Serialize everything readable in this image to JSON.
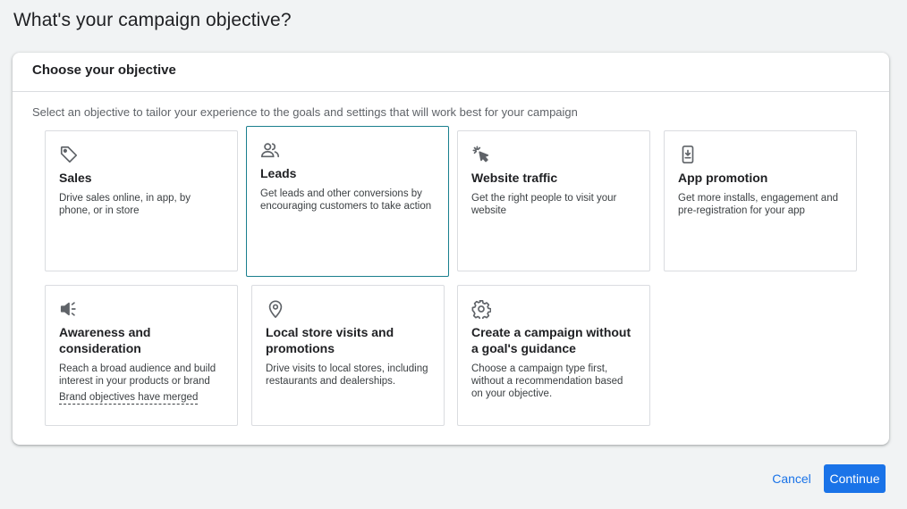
{
  "page": {
    "title": "What's your campaign objective?"
  },
  "panel": {
    "header": "Choose your objective",
    "description": "Select an objective to tailor your experience to the goals and settings that will work best for your campaign"
  },
  "objectives": [
    {
      "id": "sales",
      "icon": "tag-icon",
      "title": "Sales",
      "description": "Drive sales online, in app, by phone, or in store",
      "selected": false
    },
    {
      "id": "leads",
      "icon": "people-icon",
      "title": "Leads",
      "description": "Get leads and other conversions by encouraging customers to take action",
      "selected": true
    },
    {
      "id": "website-traffic",
      "icon": "cursor-click-icon",
      "title": "Website traffic",
      "description": "Get the right people to visit your website",
      "selected": false
    },
    {
      "id": "app-promotion",
      "icon": "phone-download-icon",
      "title": "App promotion",
      "description": "Get more installs, engagement and pre-registration for your app",
      "selected": false
    },
    {
      "id": "awareness",
      "icon": "megaphone-icon",
      "title": "Awareness and consideration",
      "description": "Reach a broad audience and build interest in your products or brand",
      "link": "Brand objectives have merged",
      "selected": false
    },
    {
      "id": "local-store",
      "icon": "location-pin-icon",
      "title": "Local store visits and promotions",
      "description": "Drive visits to local stores, including restaurants and dealerships.",
      "selected": false
    },
    {
      "id": "no-goal",
      "icon": "gear-icon",
      "title": "Create a campaign without a goal's guidance",
      "description": "Choose a campaign type first, without a recommendation based on your objective.",
      "selected": false
    }
  ],
  "actions": {
    "cancel": "Cancel",
    "continue": "Continue"
  },
  "colors": {
    "accent": "#1a73e8",
    "selected_border": "#1a7f8e"
  }
}
